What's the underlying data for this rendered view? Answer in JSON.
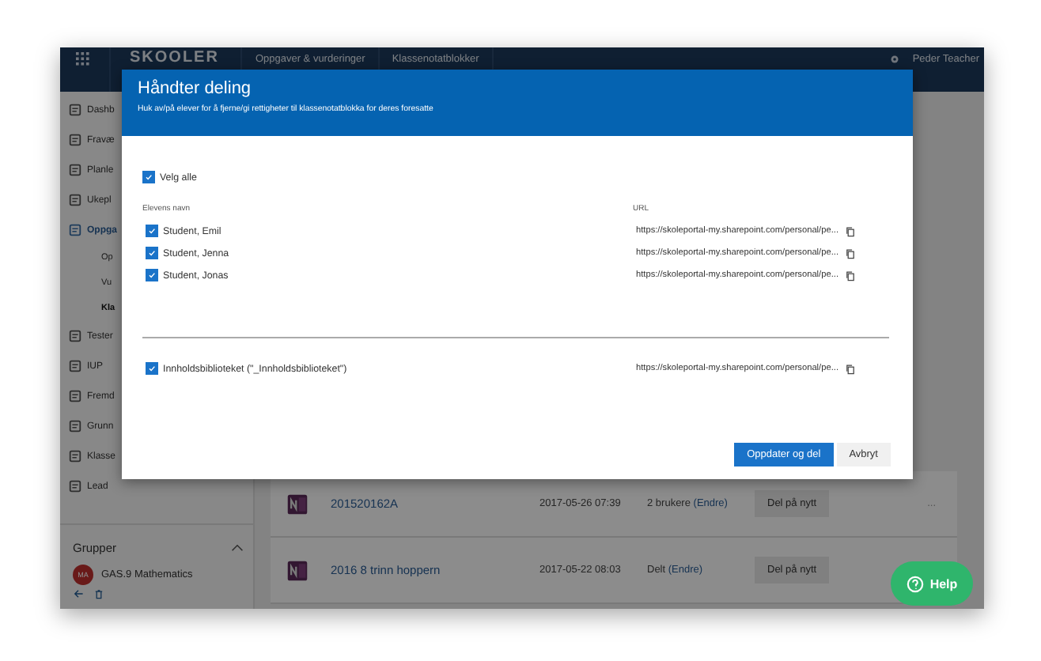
{
  "topbar": {
    "logo": "SKOOLER",
    "nav": [
      "Oppgaver & vurderinger",
      "Klassenotatblokker"
    ],
    "user": "Peder Teacher"
  },
  "sidebar": {
    "items": [
      {
        "label": "Dashb",
        "kind": "main",
        "selected": false
      },
      {
        "label": "Fravæ",
        "kind": "main",
        "selected": false
      },
      {
        "label": "Planle",
        "kind": "main",
        "selected": false
      },
      {
        "label": "Ukepl",
        "kind": "main",
        "selected": false
      },
      {
        "label": "Oppga",
        "kind": "main",
        "selected": true
      },
      {
        "label": "Op",
        "kind": "sub",
        "selected": false
      },
      {
        "label": "Vu",
        "kind": "sub",
        "selected": false
      },
      {
        "label": "Kla",
        "kind": "sub",
        "selected": true
      },
      {
        "label": "Tester",
        "kind": "main",
        "selected": false
      },
      {
        "label": "IUP",
        "kind": "main",
        "selected": false
      },
      {
        "label": "Fremd",
        "kind": "main",
        "selected": false
      },
      {
        "label": "Grunn",
        "kind": "main",
        "selected": false
      },
      {
        "label": "Klasse",
        "kind": "main",
        "selected": false
      },
      {
        "label": "Lead",
        "kind": "main",
        "selected": false
      }
    ],
    "groups_heading": "Grupper",
    "group": {
      "badge": "MA",
      "name": "GAS.9 Mathematics"
    }
  },
  "table": {
    "rows": [
      {
        "name": "201520162A",
        "date": "2017-05-26 07:39",
        "status": "2 brukere",
        "status_link": "(Endre)",
        "action": "Del på nytt",
        "more": "..."
      },
      {
        "name": "2016 8 trinn hoppern",
        "date": "2017-05-22 08:03",
        "status": "Delt",
        "status_link": "(Endre)",
        "action": "Del på nytt",
        "more": ""
      }
    ]
  },
  "dialog": {
    "title": "Håndter deling",
    "subtitle": "Huk av/på elever for å fjerne/gi rettigheter til klassenotatblokka for deres foresatte",
    "select_all": {
      "label": "Velg alle",
      "checked": true
    },
    "columns": [
      "Elevens navn",
      "URL"
    ],
    "students": [
      {
        "name": "Student, Emil",
        "checked": true,
        "url": "https://skoleportal-my.sharepoint.com/personal/pe..."
      },
      {
        "name": "Student, Jenna",
        "checked": true,
        "url": "https://skoleportal-my.sharepoint.com/personal/pe..."
      },
      {
        "name": "Student, Jonas",
        "checked": true,
        "url": "https://skoleportal-my.sharepoint.com/personal/pe..."
      }
    ],
    "library": {
      "label": "Innholdsbiblioteket (\"_Innholdsbiblioteket\")",
      "checked": true,
      "url": "https://skoleportal-my.sharepoint.com/personal/pe..."
    },
    "buttons": [
      {
        "label": "Oppdater og del",
        "kind": "primary"
      },
      {
        "label": "Avbryt",
        "kind": "secondary"
      }
    ]
  },
  "help_button": {
    "label": "Help"
  }
}
